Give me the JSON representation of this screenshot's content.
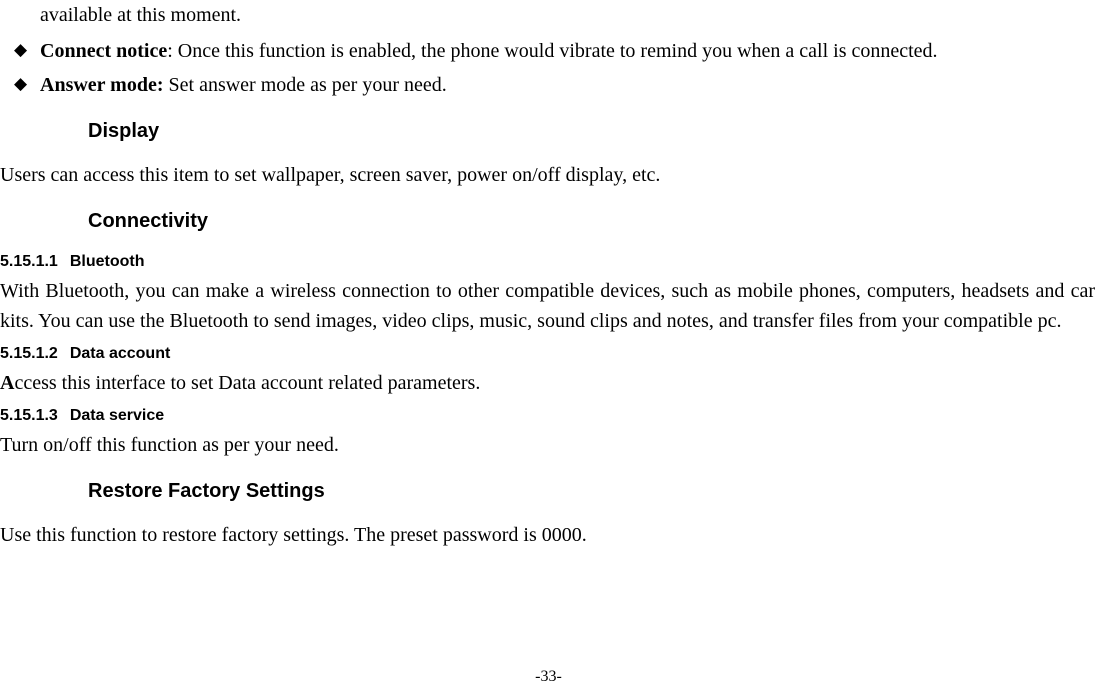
{
  "fragment_top": "available at this moment.",
  "bullets": [
    {
      "label": "Connect notice",
      "sep": ": ",
      "text": "Once this function is enabled, the phone would vibrate to remind you when a call is connected."
    },
    {
      "label": "Answer mode:",
      "sep": " ",
      "text": "Set answer mode as per your need."
    }
  ],
  "display": {
    "heading": "Display",
    "body": "Users can access this item to set wallpaper, screen saver, power on/off display, etc."
  },
  "connectivity": {
    "heading": "Connectivity",
    "sub": [
      {
        "num": "5.15.1.1",
        "title": "Bluetooth",
        "body": "With Bluetooth, you can make a wireless connection to other compatible devices, such as mobile phones, computers, headsets and car kits. You can use the Bluetooth to send images, video clips, music, sound clips and notes, and transfer files from your compatible pc."
      },
      {
        "num": "5.15.1.2",
        "title": "Data account",
        "body_first": "A",
        "body_rest": "ccess this interface to set Data account related parameters."
      },
      {
        "num": "5.15.1.3",
        "title": "Data service",
        "body": "Turn on/off this function as per your need."
      }
    ]
  },
  "restore": {
    "heading": "Restore Factory Settings",
    "body": "Use this function to restore factory settings. The preset password is 0000."
  },
  "page_number": "-33-"
}
